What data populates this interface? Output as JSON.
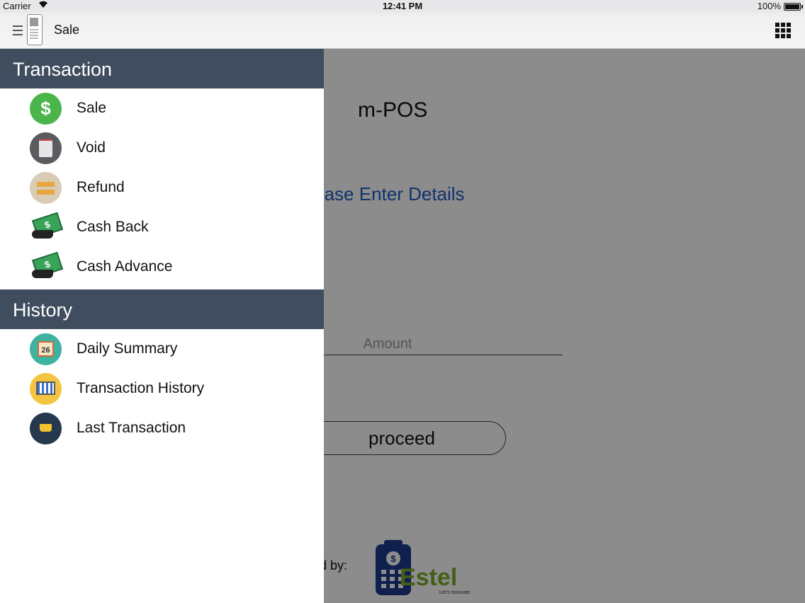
{
  "status_bar": {
    "carrier": "Carrier",
    "time": "12:41 PM",
    "battery": "100%"
  },
  "nav_bar": {
    "title": "Sale"
  },
  "main": {
    "app_title": "m-POS",
    "prompt": "Please Enter Details",
    "amount_placeholder": "Amount",
    "proceed_label": "proceed",
    "powered_by": "Powered by:",
    "logo_text": "Estel",
    "logo_tagline": "Let's Innovate"
  },
  "drawer": {
    "sections": [
      {
        "title": "Transaction",
        "items": [
          {
            "label": "Sale",
            "icon": "dollar-icon",
            "color": "#4bb54b"
          },
          {
            "label": "Void",
            "icon": "receipt-icon",
            "color": "#5a5c60"
          },
          {
            "label": "Refund",
            "icon": "refund-icon",
            "color": "#d8ccb4"
          },
          {
            "label": "Cash Back",
            "icon": "cash-hand-icon",
            "color": "#3aa35a"
          },
          {
            "label": "Cash Advance",
            "icon": "cash-advance-icon",
            "color": "#3aa35a"
          }
        ]
      },
      {
        "title": "History",
        "items": [
          {
            "label": "Daily Summary",
            "icon": "calendar-icon",
            "color": "#3fb2a0"
          },
          {
            "label": "Transaction History",
            "icon": "chart-board-icon",
            "color": "#f4c542"
          },
          {
            "label": "Last Transaction",
            "icon": "basket-icon",
            "color": "#26384d"
          }
        ]
      }
    ]
  },
  "colors": {
    "header": "#3f4d5e",
    "accent": "#1e5dc8"
  }
}
